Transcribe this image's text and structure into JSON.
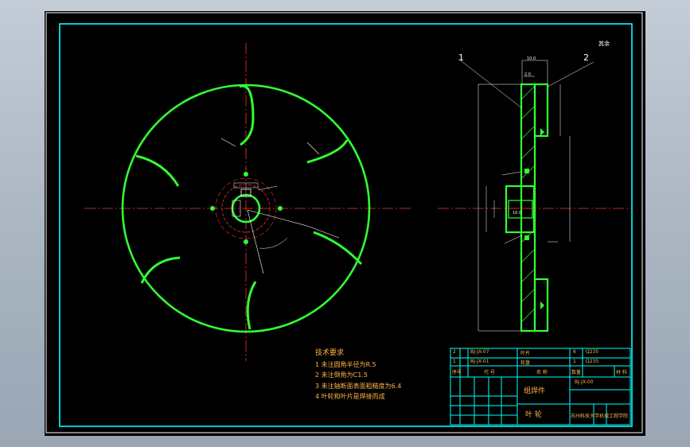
{
  "drawing": {
    "tech_requirements": {
      "title": "技术要求",
      "items": [
        "1 未注圆角半径为R.5",
        "2 未注倒角为C1.5",
        "3 未注轴断面表面粗糙度为6.4",
        "4 叶轮和叶片是焊接而成"
      ]
    },
    "callouts": {
      "part1": "1",
      "part2": "2"
    },
    "roughness_symbol": "其余",
    "dimensions": {
      "top_width": "10.0",
      "hub_width": "2.0",
      "hub_len": "10.0"
    },
    "title_block": {
      "row1_no": "2",
      "row1_code": "BJ-JX-07",
      "row1_name": "叶片",
      "row1_qty": "6",
      "row1_mat": "Q235",
      "row2_no": "1",
      "row2_code": "BJ-JX-01",
      "row2_name": "轮盘",
      "row2_qty": "1",
      "row2_mat": "Q235",
      "hdr_seq": "序号",
      "hdr_code": "代 号",
      "hdr_name": "名 称",
      "hdr_qty": "数量",
      "hdr_mat": "材 料",
      "assembly": "组焊件",
      "part_name": "叶 轮",
      "drawing_no": "BJ-JX-00",
      "school": "苏州科技大学机械工程学院"
    }
  }
}
